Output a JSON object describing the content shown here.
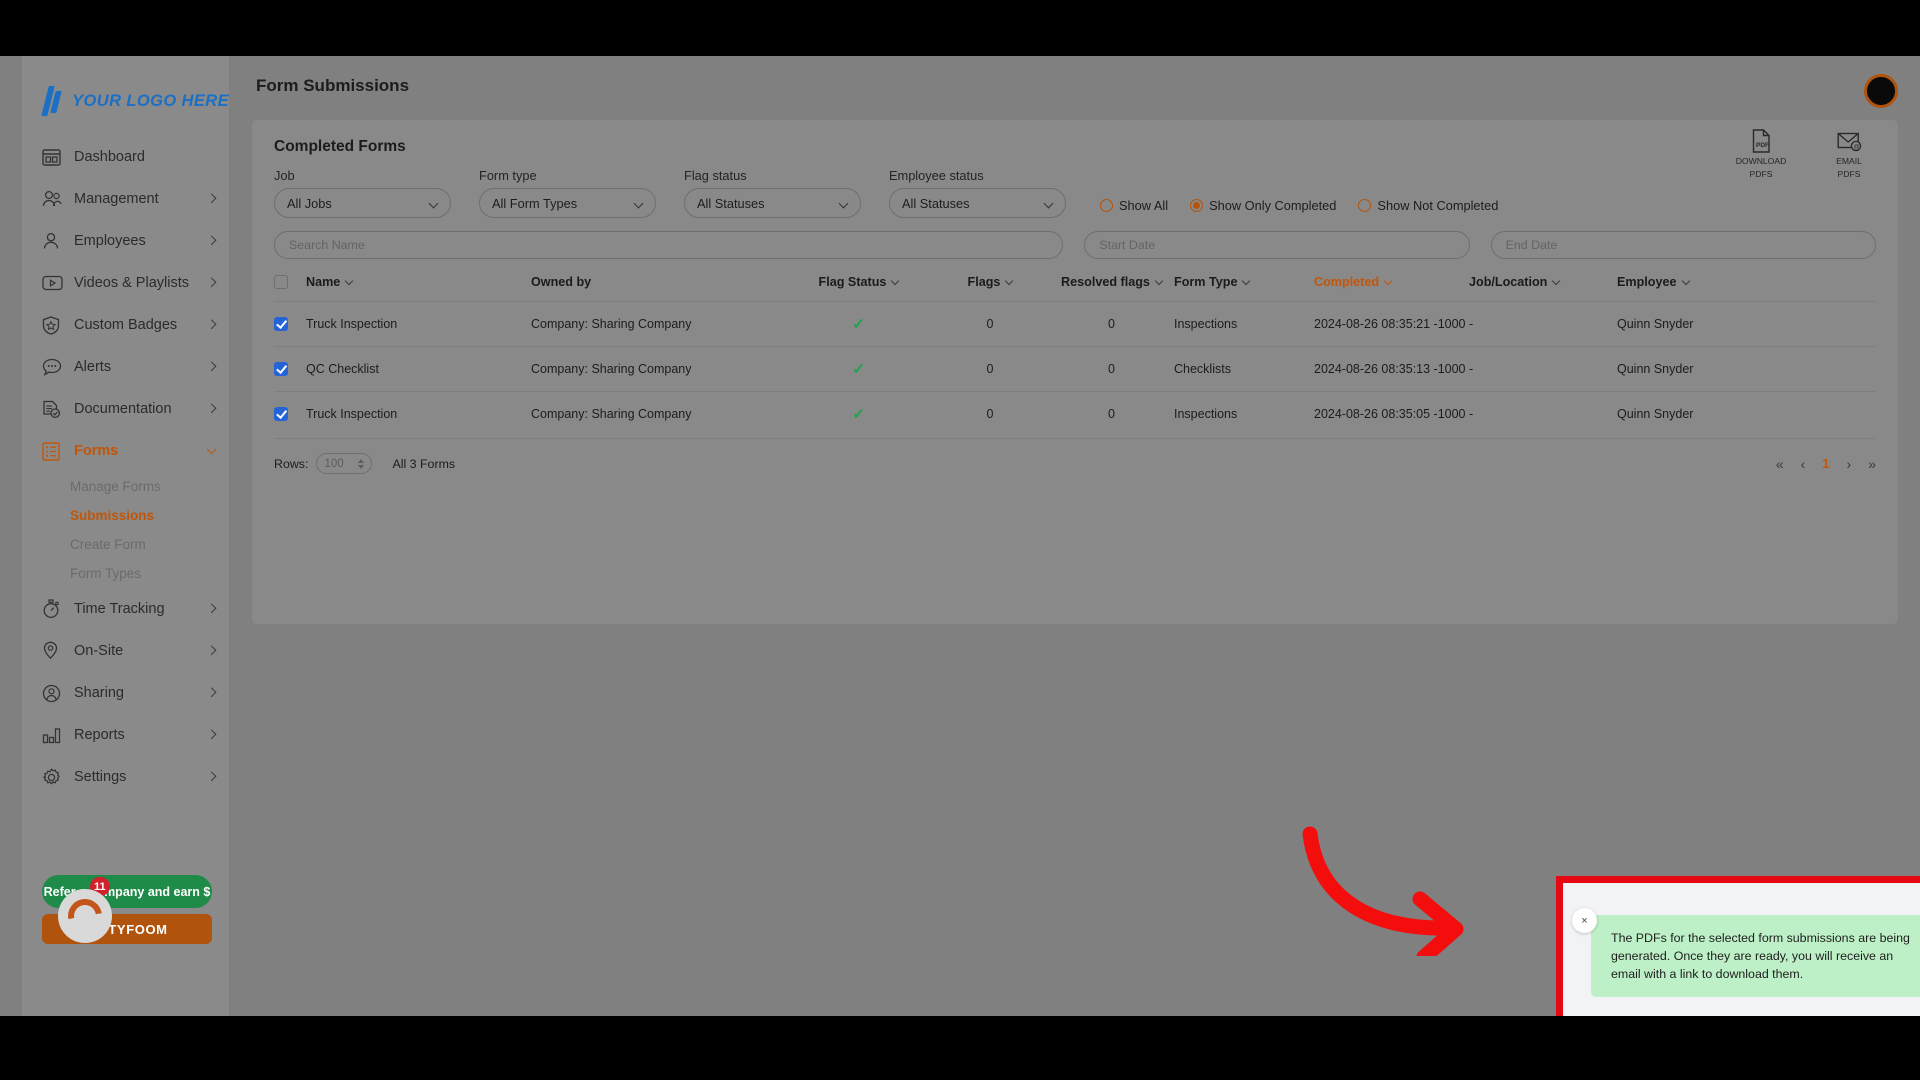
{
  "brand": {
    "logo_text": "YOUR LOGO HERE",
    "accent_orange": "#c2560b",
    "logo_blue": "#1b6fc4"
  },
  "sidebar": {
    "items": [
      {
        "label": "Dashboard",
        "icon": "dashboard-icon",
        "expandable": false
      },
      {
        "label": "Management",
        "icon": "people-icon",
        "expandable": true
      },
      {
        "label": "Employees",
        "icon": "person-icon",
        "expandable": true
      },
      {
        "label": "Videos & Playlists",
        "icon": "video-icon",
        "expandable": true
      },
      {
        "label": "Custom Badges",
        "icon": "badge-shield-icon",
        "expandable": true
      },
      {
        "label": "Alerts",
        "icon": "alert-bubble-icon",
        "expandable": true
      },
      {
        "label": "Documentation",
        "icon": "document-check-icon",
        "expandable": true
      },
      {
        "label": "Forms",
        "icon": "forms-list-icon",
        "expandable": true,
        "active": true
      },
      {
        "label": "Time Tracking",
        "icon": "stopwatch-icon",
        "expandable": true
      },
      {
        "label": "On-Site",
        "icon": "map-pin-icon",
        "expandable": true
      },
      {
        "label": "Sharing",
        "icon": "share-person-icon",
        "expandable": true
      },
      {
        "label": "Reports",
        "icon": "bar-chart-icon",
        "expandable": true
      },
      {
        "label": "Settings",
        "icon": "gear-icon",
        "expandable": true
      }
    ],
    "forms_subitems": [
      {
        "label": "Manage Forms",
        "active": false
      },
      {
        "label": "Submissions",
        "active": true
      },
      {
        "label": "Create Form",
        "active": false
      },
      {
        "label": "Form Types",
        "active": false
      }
    ],
    "promo": {
      "green_label": "Refer a company and earn $",
      "badge_count": "11",
      "orange_label": "TYFOOM"
    }
  },
  "header": {
    "title": "Form Submissions"
  },
  "card": {
    "title": "Completed Forms",
    "actions": [
      {
        "caption_line1": "DOWNLOAD",
        "caption_line2": "PDFS",
        "icon": "pdf-file-icon"
      },
      {
        "caption_line1": "EMAIL",
        "caption_line2": "PDFS",
        "icon": "email-at-icon"
      }
    ],
    "filters": [
      {
        "label": "Job",
        "value": "All Jobs"
      },
      {
        "label": "Form type",
        "value": "All Form Types"
      },
      {
        "label": "Flag status",
        "value": "All Statuses"
      },
      {
        "label": "Employee status",
        "value": "All Statuses"
      }
    ],
    "radios": [
      {
        "label": "Show All",
        "selected": false
      },
      {
        "label": "Show Only Completed",
        "selected": true
      },
      {
        "label": "Show Not Completed",
        "selected": false
      }
    ],
    "search_placeholder": "Search Name",
    "search_value": "",
    "start_date_placeholder": "Start Date",
    "start_date_value": "",
    "end_date_placeholder": "End Date",
    "end_date_value": ""
  },
  "table": {
    "columns": [
      {
        "label": "Name",
        "sortable": true,
        "sorted": false
      },
      {
        "label": "Owned by",
        "sortable": false,
        "sorted": false
      },
      {
        "label": "Flag Status",
        "sortable": true,
        "sorted": false
      },
      {
        "label": "Flags",
        "sortable": true,
        "sorted": false
      },
      {
        "label": "Resolved flags",
        "sortable": true,
        "sorted": false
      },
      {
        "label": "Form Type",
        "sortable": true,
        "sorted": false
      },
      {
        "label": "Completed",
        "sortable": true,
        "sorted": true
      },
      {
        "label": "Job/Location",
        "sortable": true,
        "sorted": false
      },
      {
        "label": "Employee",
        "sortable": true,
        "sorted": false
      }
    ],
    "header_checkbox_checked": false,
    "rows": [
      {
        "checked": true,
        "name": "Truck Inspection",
        "owned_by": "Company: Sharing Company",
        "flag_status": "✓",
        "flags": "0",
        "resolved_flags": "0",
        "form_type": "Inspections",
        "completed": "2024-08-26 08:35:21 -1000",
        "job_location": "-",
        "employee": "Quinn Snyder"
      },
      {
        "checked": true,
        "name": "QC Checklist",
        "owned_by": "Company: Sharing Company",
        "flag_status": "✓",
        "flags": "0",
        "resolved_flags": "0",
        "form_type": "Checklists",
        "completed": "2024-08-26 08:35:13 -1000",
        "job_location": "-",
        "employee": "Quinn Snyder"
      },
      {
        "checked": true,
        "name": "Truck Inspection",
        "owned_by": "Company: Sharing Company",
        "flag_status": "✓",
        "flags": "0",
        "resolved_flags": "0",
        "form_type": "Inspections",
        "completed": "2024-08-26 08:35:05 -1000",
        "job_location": "-",
        "employee": "Quinn Snyder"
      }
    ],
    "footer": {
      "rows_label": "Rows:",
      "rows_value": "100",
      "count_text": "All 3 Forms",
      "pager": {
        "first": "«",
        "prev": "‹",
        "current_page": "1",
        "next": "›",
        "last": "»"
      }
    }
  },
  "toast": {
    "close_label": "×",
    "message": "The PDFs for the selected form submissions are being generated. Once they are ready, you will receive an email with a link to download them.",
    "highlight_color": "#e50914",
    "body_color": "#bdf0c6"
  },
  "annotation": {
    "arrow_color": "#f40d0d",
    "type": "curved-arrow-pointing-right"
  }
}
